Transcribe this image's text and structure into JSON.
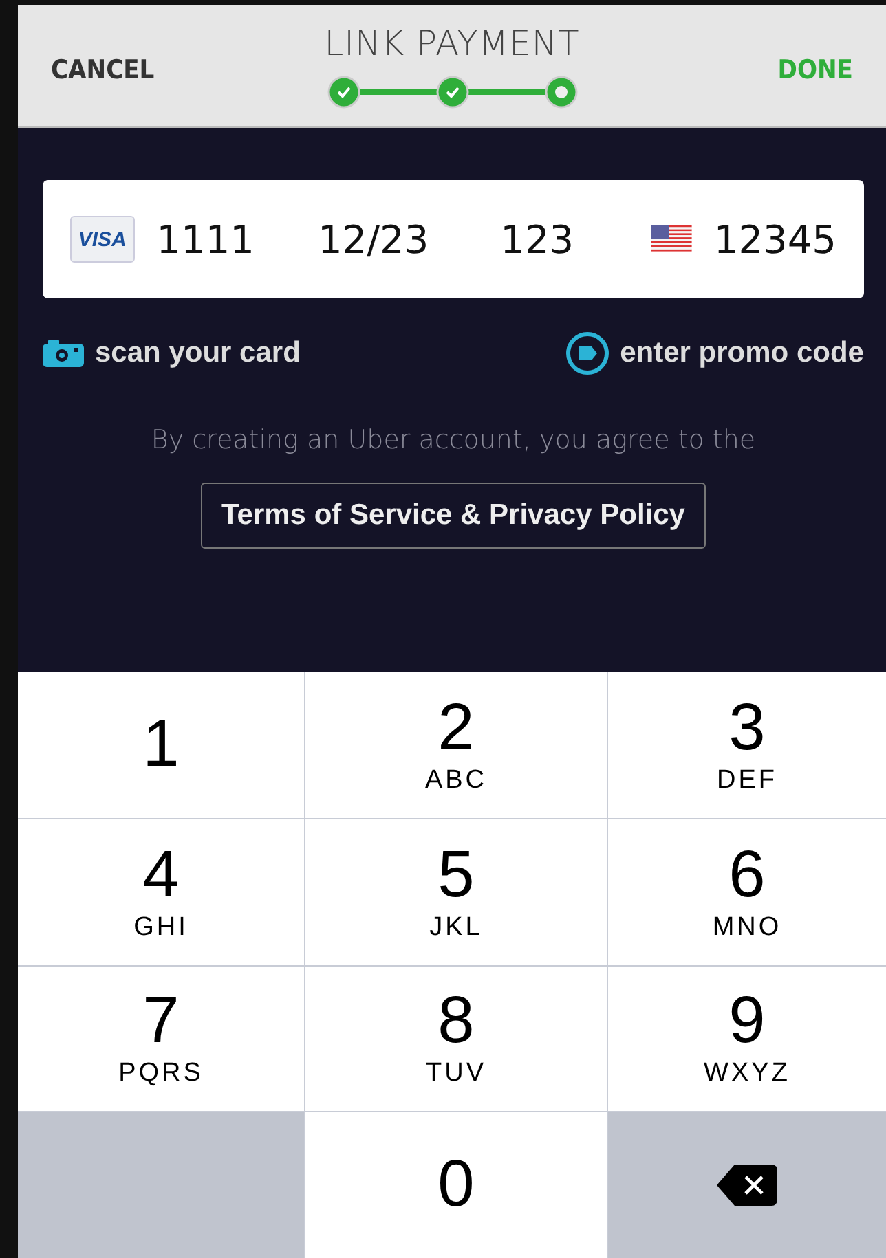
{
  "header": {
    "cancel": "CANCEL",
    "title": "LINK PAYMENT",
    "done": "DONE",
    "steps": [
      {
        "kind": "done"
      },
      {
        "kind": "done"
      },
      {
        "kind": "current"
      }
    ]
  },
  "card": {
    "brand": "VISA",
    "number": "1111",
    "expiry": "12/23",
    "cvv": "123",
    "zip": "12345"
  },
  "actions": {
    "scan": "scan your card",
    "promo": "enter promo code"
  },
  "agreement": {
    "text": "By creating an Uber account, you agree to the",
    "link": "Terms of Service & Privacy Policy"
  },
  "keypad": [
    {
      "kind": "digit",
      "digit": "1"
    },
    {
      "kind": "digit",
      "digit": "2",
      "letters": "ABC"
    },
    {
      "kind": "digit",
      "digit": "3",
      "letters": "DEF"
    },
    {
      "kind": "digit",
      "digit": "4",
      "letters": "GHI"
    },
    {
      "kind": "digit",
      "digit": "5",
      "letters": "JKL"
    },
    {
      "kind": "digit",
      "digit": "6",
      "letters": "MNO"
    },
    {
      "kind": "digit",
      "digit": "7",
      "letters": "PQRS"
    },
    {
      "kind": "digit",
      "digit": "8",
      "letters": "TUV"
    },
    {
      "kind": "digit",
      "digit": "9",
      "letters": "WXYZ"
    },
    {
      "kind": "blank"
    },
    {
      "kind": "digit",
      "digit": "0"
    },
    {
      "kind": "delete"
    }
  ]
}
